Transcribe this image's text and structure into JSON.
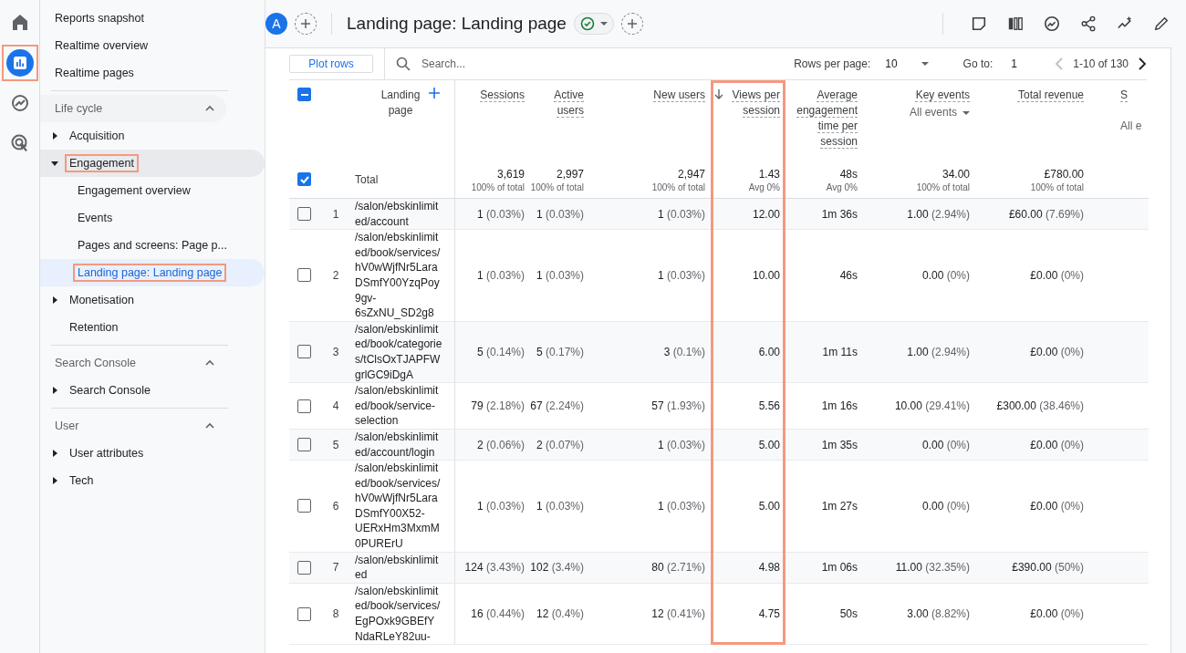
{
  "rail": [
    {
      "kind": "home",
      "selected": false,
      "annotated": false
    },
    {
      "kind": "reports",
      "selected": true,
      "annotated": true
    },
    {
      "kind": "explore",
      "selected": false,
      "annotated": false
    },
    {
      "kind": "advertising",
      "selected": false,
      "annotated": false
    }
  ],
  "sidebar": {
    "top_items": [
      {
        "label": "Reports snapshot"
      },
      {
        "label": "Realtime overview"
      },
      {
        "label": "Realtime pages"
      }
    ],
    "sections": [
      {
        "title": "Life cycle",
        "expanded": true,
        "items": [
          {
            "label": "Acquisition",
            "expandable": true,
            "expanded": false,
            "annotated": false
          },
          {
            "label": "Engagement",
            "expandable": true,
            "expanded": true,
            "annotated": true,
            "children": [
              {
                "label": "Engagement overview",
                "selected": false,
                "annotated": false
              },
              {
                "label": "Events",
                "selected": false,
                "annotated": false
              },
              {
                "label": "Pages and screens: Page p...",
                "selected": false,
                "annotated": false
              },
              {
                "label": "Landing page: Landing page",
                "selected": true,
                "annotated": true
              }
            ]
          },
          {
            "label": "Monetisation",
            "expandable": true,
            "expanded": false,
            "annotated": false
          },
          {
            "label": "Retention",
            "expandable": false,
            "expanded": false,
            "annotated": false
          }
        ]
      },
      {
        "title": "Search Console",
        "expanded": true,
        "items": [
          {
            "label": "Search Console",
            "expandable": true,
            "expanded": false,
            "annotated": false
          }
        ]
      },
      {
        "title": "User",
        "expanded": true,
        "items": [
          {
            "label": "User attributes",
            "expandable": true,
            "expanded": false,
            "annotated": false
          },
          {
            "label": "Tech",
            "expandable": true,
            "expanded": false,
            "annotated": false
          }
        ]
      }
    ]
  },
  "header": {
    "avatar": "A",
    "title": "Landing page: Landing page"
  },
  "toolbar": {
    "plot_button": "Plot rows",
    "search_placeholder": "Search...",
    "rows_per_page_label": "Rows per page:",
    "rows_per_page": "10",
    "goto_label": "Go to:",
    "goto_value": "1",
    "range": "1-10 of 130",
    "prev_disabled": true
  },
  "table": {
    "select_all_indeterminate": true,
    "dimension": "Landing page",
    "columns": [
      {
        "label": "Sessions",
        "sorted": false,
        "annotated": false
      },
      {
        "label": "Active users",
        "sorted": false,
        "annotated": false
      },
      {
        "label": "New users",
        "sorted": false,
        "annotated": false
      },
      {
        "label": "Views per session",
        "sorted": true,
        "annotated": true
      },
      {
        "label": "Average engagement time per session",
        "sorted": false,
        "annotated": false
      },
      {
        "label": "Key events",
        "filter": "All events",
        "sorted": false,
        "annotated": false
      },
      {
        "label": "Total revenue",
        "sorted": false,
        "annotated": false
      },
      {
        "label": "S",
        "filter": "All e",
        "sorted": false,
        "annotated": false
      }
    ],
    "total": {
      "label": "Total",
      "checked": true,
      "values": [
        {
          "value": "3,619",
          "note": "100% of total"
        },
        {
          "value": "2,997",
          "note": "100% of total"
        },
        {
          "value": "2,947",
          "note": "100% of total"
        },
        {
          "value": "1.43",
          "note": "Avg 0%"
        },
        {
          "value": "48s",
          "note": "Avg 0%"
        },
        {
          "value": "34.00",
          "note": "100% of total"
        },
        {
          "value": "£780.00",
          "note": "100% of total"
        }
      ]
    },
    "rows": [
      {
        "index": "1",
        "page": "/salon/ebskinlimited/account",
        "checked": false,
        "values": [
          {
            "value": "1",
            "share": "(0.03%)"
          },
          {
            "value": "1",
            "share": "(0.03%)"
          },
          {
            "value": "1",
            "share": "(0.03%)"
          },
          {
            "value": "12.00"
          },
          {
            "value": "1m 36s"
          },
          {
            "value": "1.00",
            "share": "(2.94%)"
          },
          {
            "value": "£60.00",
            "share": "(7.69%)"
          }
        ]
      },
      {
        "index": "2",
        "page": "/salon/ebskinlimited/book/services/hV0wWjfNr5LaraDSmfY00YzqPoy9gv-6sZxNU_SD2g8",
        "checked": false,
        "values": [
          {
            "value": "1",
            "share": "(0.03%)"
          },
          {
            "value": "1",
            "share": "(0.03%)"
          },
          {
            "value": "1",
            "share": "(0.03%)"
          },
          {
            "value": "10.00"
          },
          {
            "value": "46s"
          },
          {
            "value": "0.00",
            "share": "(0%)"
          },
          {
            "value": "£0.00",
            "share": "(0%)"
          }
        ]
      },
      {
        "index": "3",
        "page": "/salon/ebskinlimited/book/categories/tClsOxTJAPFWgrlGC9iDgA",
        "checked": false,
        "values": [
          {
            "value": "5",
            "share": "(0.14%)"
          },
          {
            "value": "5",
            "share": "(0.17%)"
          },
          {
            "value": "3",
            "share": "(0.1%)"
          },
          {
            "value": "6.00"
          },
          {
            "value": "1m 11s"
          },
          {
            "value": "1.00",
            "share": "(2.94%)"
          },
          {
            "value": "£0.00",
            "share": "(0%)"
          }
        ]
      },
      {
        "index": "4",
        "page": "/salon/ebskinlimited/book/service-selection",
        "checked": false,
        "values": [
          {
            "value": "79",
            "share": "(2.18%)"
          },
          {
            "value": "67",
            "share": "(2.24%)"
          },
          {
            "value": "57",
            "share": "(1.93%)"
          },
          {
            "value": "5.56"
          },
          {
            "value": "1m 16s"
          },
          {
            "value": "10.00",
            "share": "(29.41%)"
          },
          {
            "value": "£300.00",
            "share": "(38.46%)"
          }
        ]
      },
      {
        "index": "5",
        "page": "/salon/ebskinlimited/account/login",
        "checked": false,
        "values": [
          {
            "value": "2",
            "share": "(0.06%)"
          },
          {
            "value": "2",
            "share": "(0.07%)"
          },
          {
            "value": "1",
            "share": "(0.03%)"
          },
          {
            "value": "5.00"
          },
          {
            "value": "1m 35s"
          },
          {
            "value": "0.00",
            "share": "(0%)"
          },
          {
            "value": "£0.00",
            "share": "(0%)"
          }
        ]
      },
      {
        "index": "6",
        "page": "/salon/ebskinlimited/book/services/hV0wWjfNr5LaraDSmfY00X52-UERxHm3MxmM0PURErU",
        "checked": false,
        "values": [
          {
            "value": "1",
            "share": "(0.03%)"
          },
          {
            "value": "1",
            "share": "(0.03%)"
          },
          {
            "value": "1",
            "share": "(0.03%)"
          },
          {
            "value": "5.00"
          },
          {
            "value": "1m 27s"
          },
          {
            "value": "0.00",
            "share": "(0%)"
          },
          {
            "value": "£0.00",
            "share": "(0%)"
          }
        ]
      },
      {
        "index": "7",
        "page": "/salon/ebskinlimited",
        "checked": false,
        "values": [
          {
            "value": "124",
            "share": "(3.43%)"
          },
          {
            "value": "102",
            "share": "(3.4%)"
          },
          {
            "value": "80",
            "share": "(2.71%)"
          },
          {
            "value": "4.98"
          },
          {
            "value": "1m 06s"
          },
          {
            "value": "11.00",
            "share": "(32.35%)"
          },
          {
            "value": "£390.00",
            "share": "(50%)"
          }
        ]
      },
      {
        "index": "8",
        "page": "/salon/ebskinlimited/book/services/EgPOxk9GBEfYNdaRLeY82uu-",
        "checked": false,
        "values": [
          {
            "value": "16",
            "share": "(0.44%)"
          },
          {
            "value": "12",
            "share": "(0.4%)"
          },
          {
            "value": "12",
            "share": "(0.41%)"
          },
          {
            "value": "4.75"
          },
          {
            "value": "50s"
          },
          {
            "value": "3.00",
            "share": "(8.82%)"
          },
          {
            "value": "£0.00",
            "share": "(0%)"
          }
        ]
      }
    ]
  }
}
